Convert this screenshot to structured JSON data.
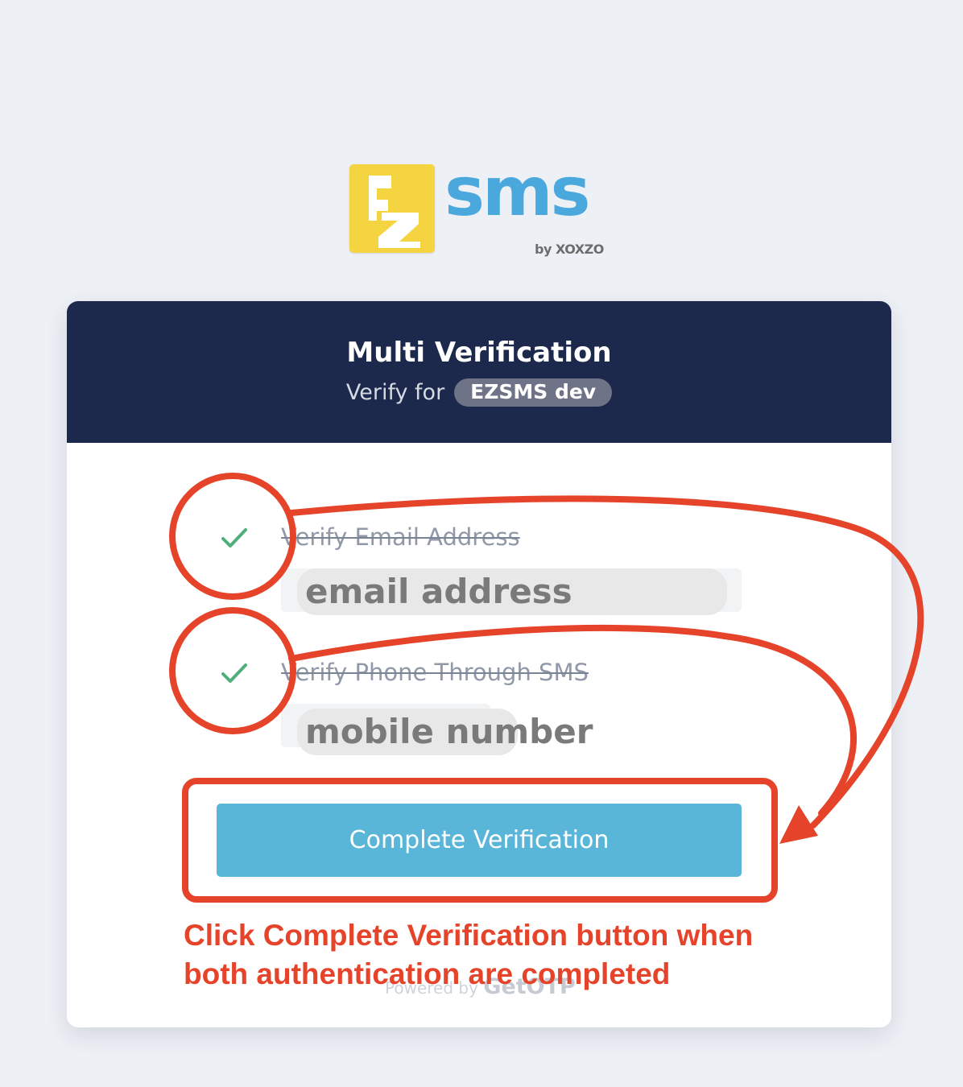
{
  "logo": {
    "word": "sms",
    "byline": "by XOXZO",
    "mark_color": "#f5d442",
    "word_color": "#4ba8dd"
  },
  "header": {
    "title": "Multi Verification",
    "subtitle_label": "Verify for",
    "org_name": "EZSMS dev",
    "background": "#1c284c"
  },
  "steps": [
    {
      "label": "Verify Email Address",
      "status": "completed",
      "icon": "check-icon",
      "field_text": "email address"
    },
    {
      "label": "Verify Phone Through SMS",
      "status": "completed",
      "icon": "check-icon",
      "field_text": "mobile number"
    }
  ],
  "actions": {
    "complete_label": "Complete Verification",
    "button_color": "#59b6d9"
  },
  "footer": {
    "powered_by_label": "Powered by",
    "powered_by_brand": "GetOTP"
  },
  "annotation": {
    "note_line1": "Click Complete Verification button when",
    "note_line2": "both authentication are completed",
    "color": "#e5432a"
  }
}
